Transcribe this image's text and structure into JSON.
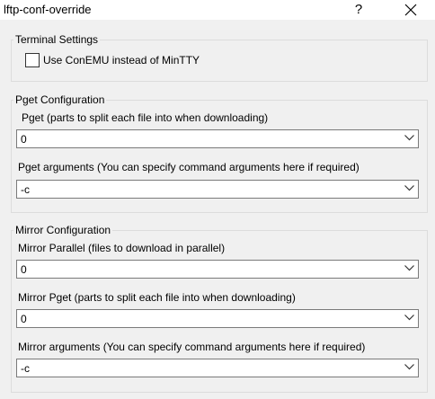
{
  "window": {
    "title": "lftp-conf-override",
    "help_label": "?"
  },
  "terminal": {
    "legend": "Terminal Settings",
    "conemu_label": "Use ConEMU instead of MinTTY",
    "conemu_checked": false
  },
  "pget": {
    "legend": "Pget Configuration",
    "parts_label": "Pget (parts to split each file into when downloading)",
    "parts_value": "0",
    "args_label": "Pget arguments (You can specify command arguments here if required)",
    "args_value": "-c"
  },
  "mirror": {
    "legend": "Mirror Configuration",
    "parallel_label": "Mirror Parallel (files to download in parallel)",
    "parallel_value": "0",
    "pget_label": "Mirror Pget (parts to split each file into when downloading)",
    "pget_value": "0",
    "args_label": "Mirror arguments (You can specify command arguments here if required)",
    "args_value": "-c"
  }
}
